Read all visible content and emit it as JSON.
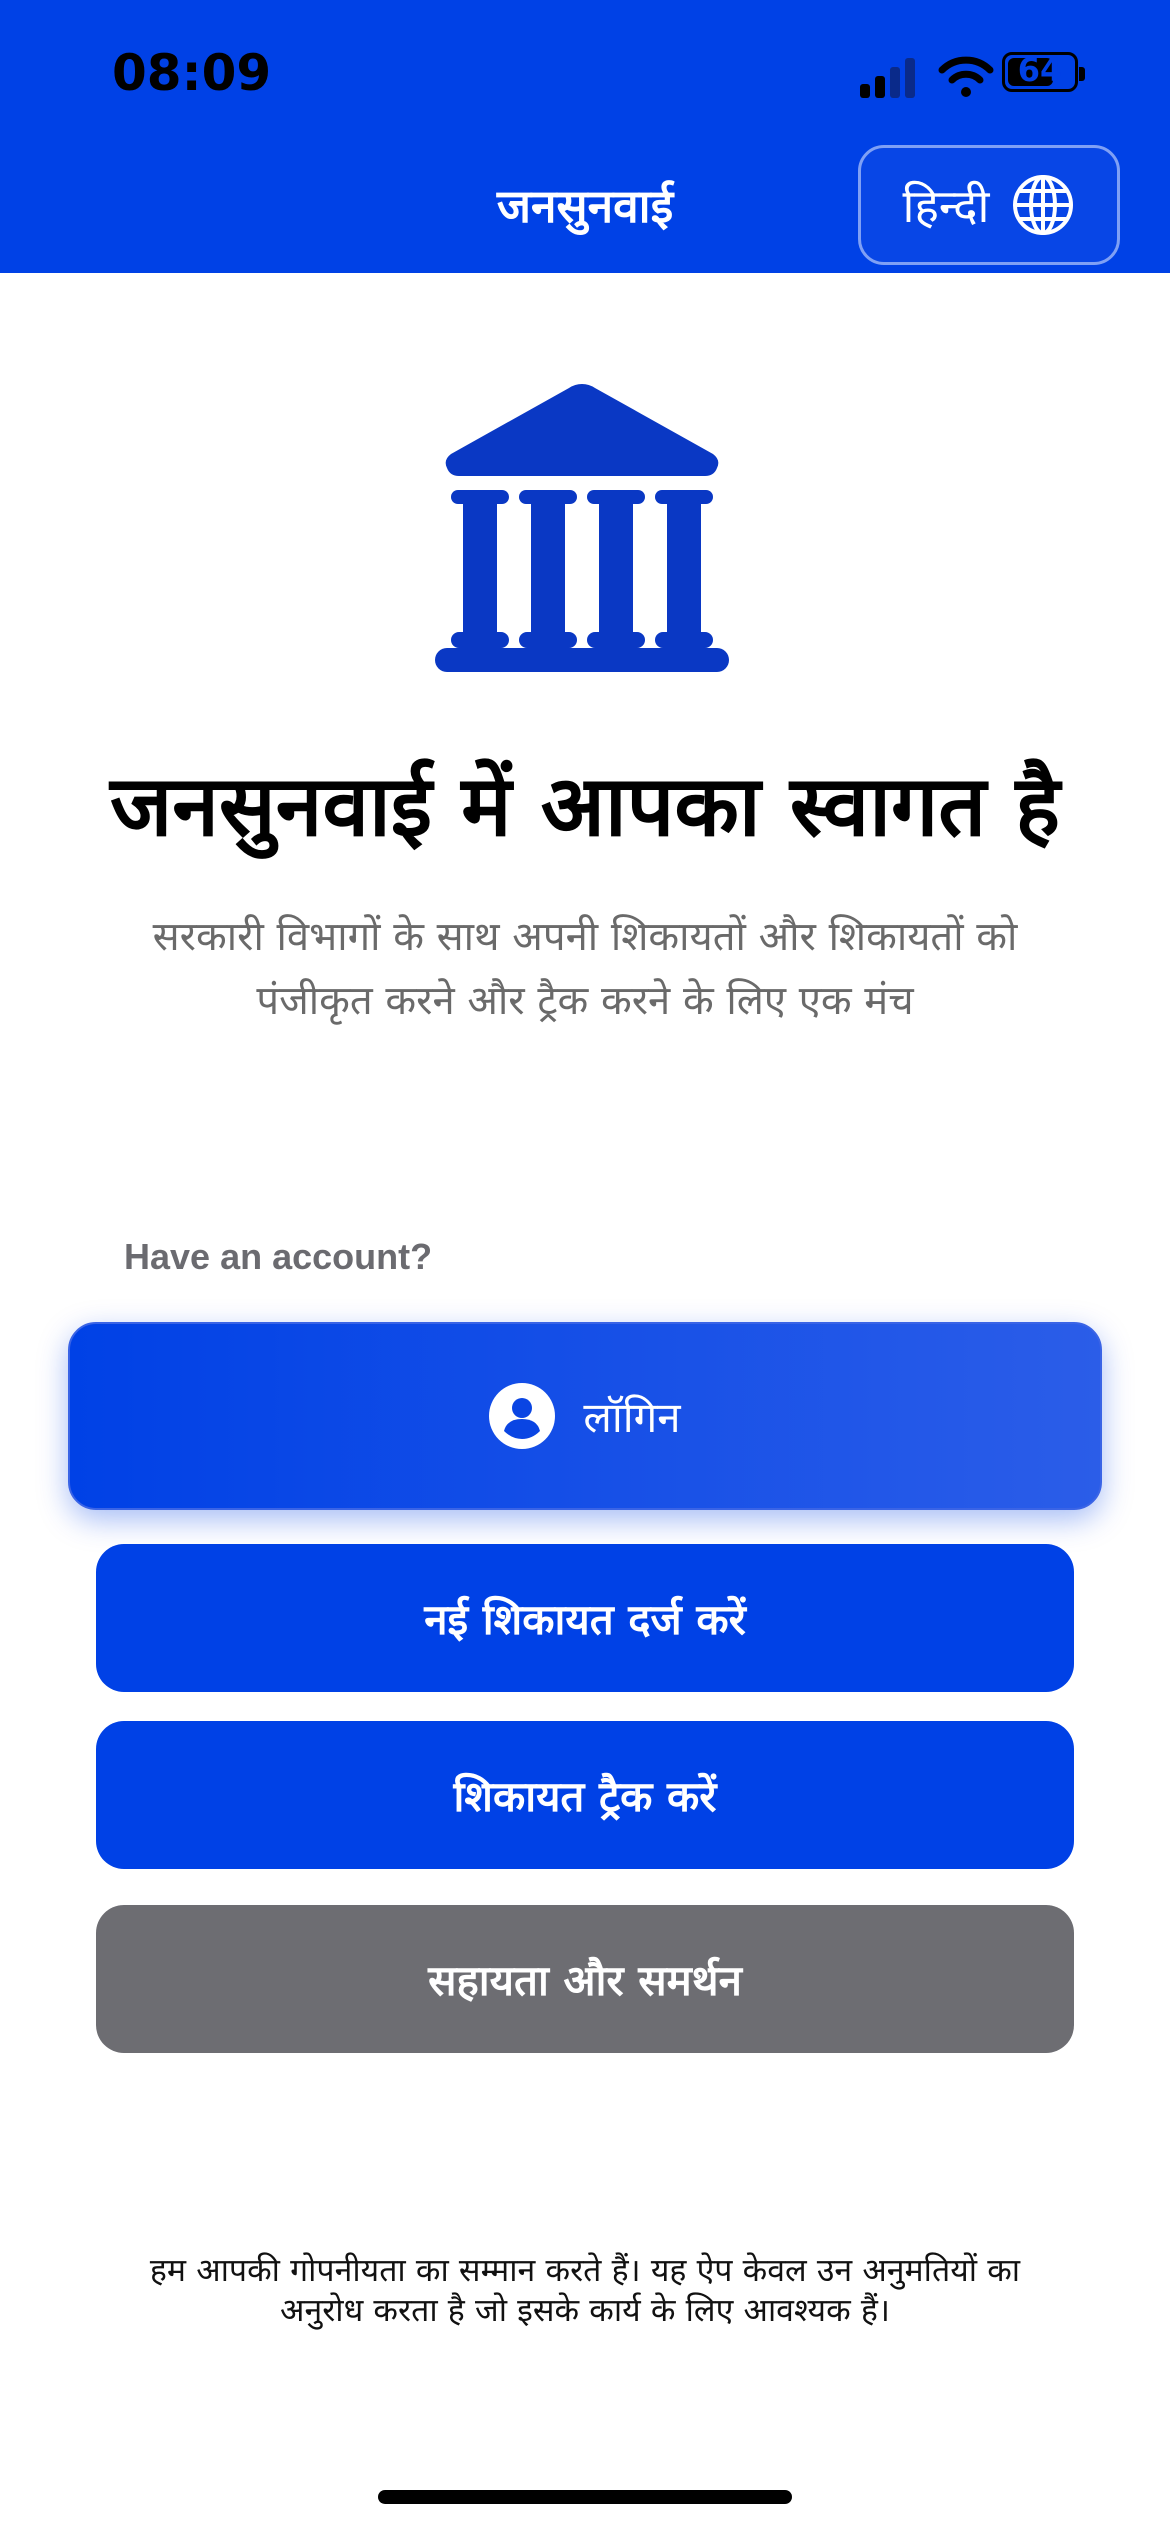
{
  "status_bar": {
    "time": "08:09",
    "battery_level": "64"
  },
  "header": {
    "title": "जनसुनवाई",
    "language_label": "हिन्दी",
    "language_icon": "globe-icon"
  },
  "hero": {
    "icon": "bank-building-icon",
    "title": "जनसुनवाई में आपका स्वागत है",
    "subtitle": "सरकारी विभागों के साथ अपनी शिकायतों और शिकायतों को पंजीकृत करने और ट्रैक करने के लिए एक मंच"
  },
  "actions": {
    "account_prompt": "Have an account?",
    "login_label": "लॉगिन",
    "login_icon": "user-circle-icon",
    "new_complaint_label": "नई शिकायत दर्ज करें",
    "track_complaint_label": "शिकायत ट्रैक करें",
    "help_label": "सहायता और समर्थन"
  },
  "footer": {
    "privacy_note": "हम आपकी गोपनीयता का सम्मान करते हैं। यह ऐप केवल उन अनुमतियों का अनुरोध करता है जो इसके कार्य के लिए आवश्यक हैं।"
  },
  "colors": {
    "primary": "#0041e6",
    "secondary_button": "#6d6d72",
    "header_text": "#ffffff"
  }
}
